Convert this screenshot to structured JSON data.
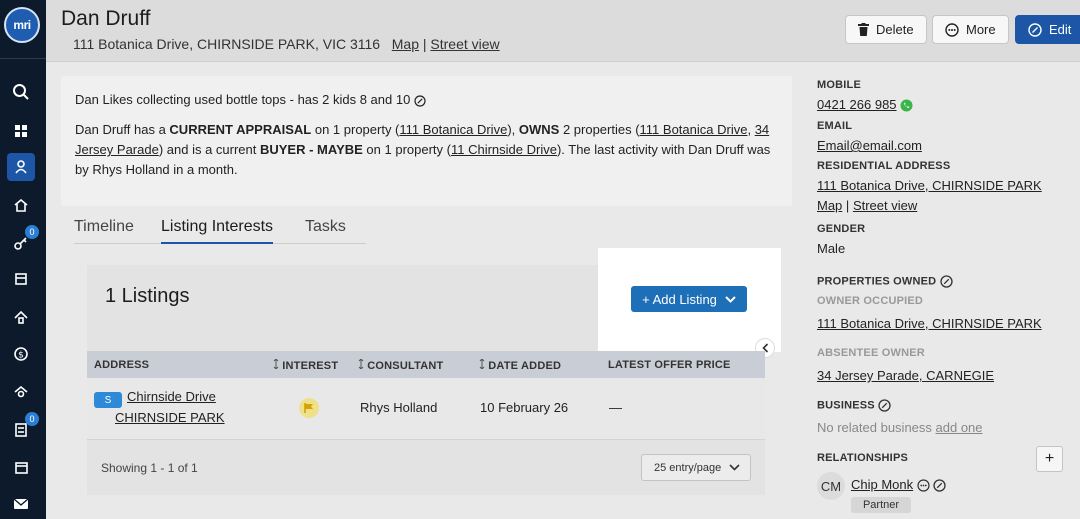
{
  "brand": {
    "logo_text": "mri"
  },
  "sidebar": {
    "items": [
      {
        "name": "search-icon"
      },
      {
        "name": "grid-icon"
      },
      {
        "name": "contacts-icon",
        "active": true
      },
      {
        "name": "home-icon"
      },
      {
        "name": "key-icon",
        "badge": "0"
      },
      {
        "name": "building-icon"
      },
      {
        "name": "house-icon"
      },
      {
        "name": "dollar-icon"
      },
      {
        "name": "house-search-icon"
      },
      {
        "name": "tasks-icon",
        "badge": "0"
      },
      {
        "name": "calendar-icon"
      },
      {
        "name": "mail-icon"
      }
    ]
  },
  "header": {
    "title": "Dan Druff",
    "address": "111 Botanica Drive, CHIRNSIDE PARK, VIC 3116",
    "map_link": "Map",
    "separator": "|",
    "street_view_link": "Street view",
    "delete_label": "Delete",
    "more_label": "More",
    "edit_label": "Edit"
  },
  "summary": {
    "note": "Dan Likes collecting used bottle tops - has 2 kids 8 and 10",
    "p1": "Dan Druff has a ",
    "b1": "CURRENT APPRAISAL",
    "p2": " on 1 property (",
    "l1": "111 Botanica Drive",
    "p3": "), ",
    "b2": "OWNS",
    "p4": " 2 properties (",
    "l2": "111 Botanica Drive",
    "p5": ", ",
    "l3": "34 Jersey Parade",
    "p6": ") and is a current ",
    "b3": "BUYER - MAYBE",
    "p7": " on 1 property (",
    "l4": "11 Chirnside Drive",
    "p8": "). The last activity with Dan Druff was by Rhys Holland in a month."
  },
  "tabs": [
    {
      "label": "Timeline"
    },
    {
      "label": "Listing Interests",
      "active": true
    },
    {
      "label": "Tasks"
    }
  ],
  "listings": {
    "title": "1 Listings",
    "add_label": "+ Add Listing",
    "columns": [
      "ADDRESS",
      "INTEREST",
      "CONSULTANT",
      "DATE ADDED",
      "LATEST OFFER PRICE"
    ],
    "rows": [
      {
        "status": "S",
        "address_line1": "Chirnside Drive",
        "address_line2": "CHIRNSIDE PARK",
        "consultant": "Rhys Holland",
        "date_added": "10 February 26",
        "latest_offer": "—"
      }
    ],
    "showing": "Showing 1 - 1 of 1",
    "per_page": "25 entry/page"
  },
  "details": {
    "mobile_label": "MOBILE",
    "mobile": "0421 266 985",
    "email_label": "EMAIL",
    "email": "Email@email.com",
    "res_label": "RESIDENTIAL ADDRESS",
    "res_address": "111 Botanica Drive, CHIRNSIDE PARK",
    "map_link": "Map",
    "separator": "|",
    "street_view_link": "Street view",
    "gender_label": "GENDER",
    "gender": "Male",
    "props_label": "PROPERTIES OWNED",
    "owner_occ_label": "OWNER OCCUPIED",
    "owner_occ_address": "111 Botanica Drive, CHIRNSIDE PARK",
    "absentee_label": "ABSENTEE OWNER",
    "absentee_address": "34 Jersey Parade, CARNEGIE",
    "business_label": "BUSINESS",
    "business_text": "No related business ",
    "business_add": "add one",
    "relationships_label": "RELATIONSHIPS",
    "relationships_add": "+",
    "relation_initials": "CM",
    "relation_name": "Chip Monk",
    "relation_role": "Partner"
  },
  "colors": {
    "primary": "#1d56a6",
    "sidebar": "#0c1a2b",
    "accent_button": "#1d6fb8"
  }
}
